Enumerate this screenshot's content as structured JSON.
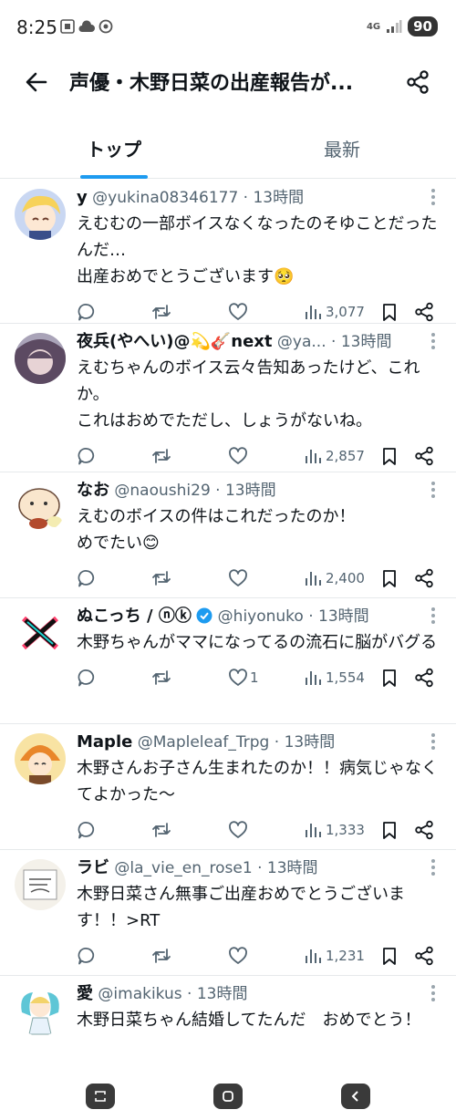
{
  "status": {
    "time": "8:25",
    "network": "4G",
    "battery": "90"
  },
  "header": {
    "title": "声優・木野日菜の出産報告が..."
  },
  "tabs": [
    {
      "label": "トップ"
    },
    {
      "label": "最新"
    }
  ],
  "tweets": [
    {
      "name": "y",
      "handle": "@yukina08346177",
      "time": "13時間",
      "text": "えむむの一部ボイスなくなったのそゆことだったんだ…\n出産おめでとうございます🥺",
      "likes": "",
      "views": "3,077"
    },
    {
      "name": "夜兵(やへい)@💫🎸next",
      "handle": "@ya...",
      "time": "13時間",
      "text": "えむちゃんのボイス云々告知あったけど、これか。\nこれはおめでただし、しょうがないね。",
      "likes": "",
      "views": "2,857"
    },
    {
      "name": "なお",
      "handle": "@naoushi29",
      "time": "13時間",
      "text": "えむのボイスの件はこれだったのか！\nめでたい😊",
      "likes": "",
      "views": "2,400"
    },
    {
      "name": "ぬこっち / ⓝⓚ",
      "handle": "@hiyonuko",
      "time": "13時間",
      "text": "木野ちゃんがママになってるの流石に脳がバグる",
      "likes": "1",
      "views": "1,554"
    },
    {
      "name": "Maple",
      "handle": "@Mapleleaf_Trpg",
      "time": "13時間",
      "text": "木野さんお子さん生まれたのか！！病気じゃなくてよかった〜",
      "likes": "",
      "views": "1,333"
    },
    {
      "name": "ラビ",
      "handle": "@la_vie_en_rose1",
      "time": "13時間",
      "text": "木野日菜さん無事ご出産おめでとうございます！！>RT",
      "likes": "",
      "views": "1,231"
    },
    {
      "name": "愛",
      "handle": "@imakikus",
      "time": "13時間",
      "text": "木野日菜ちゃん結婚してたんだ　おめでとう！",
      "likes": "",
      "views": ""
    }
  ],
  "colors": {
    "accent": "#1d9bf0",
    "text": "#0f1419",
    "muted": "#536471",
    "verified": "#1d9bf0"
  }
}
